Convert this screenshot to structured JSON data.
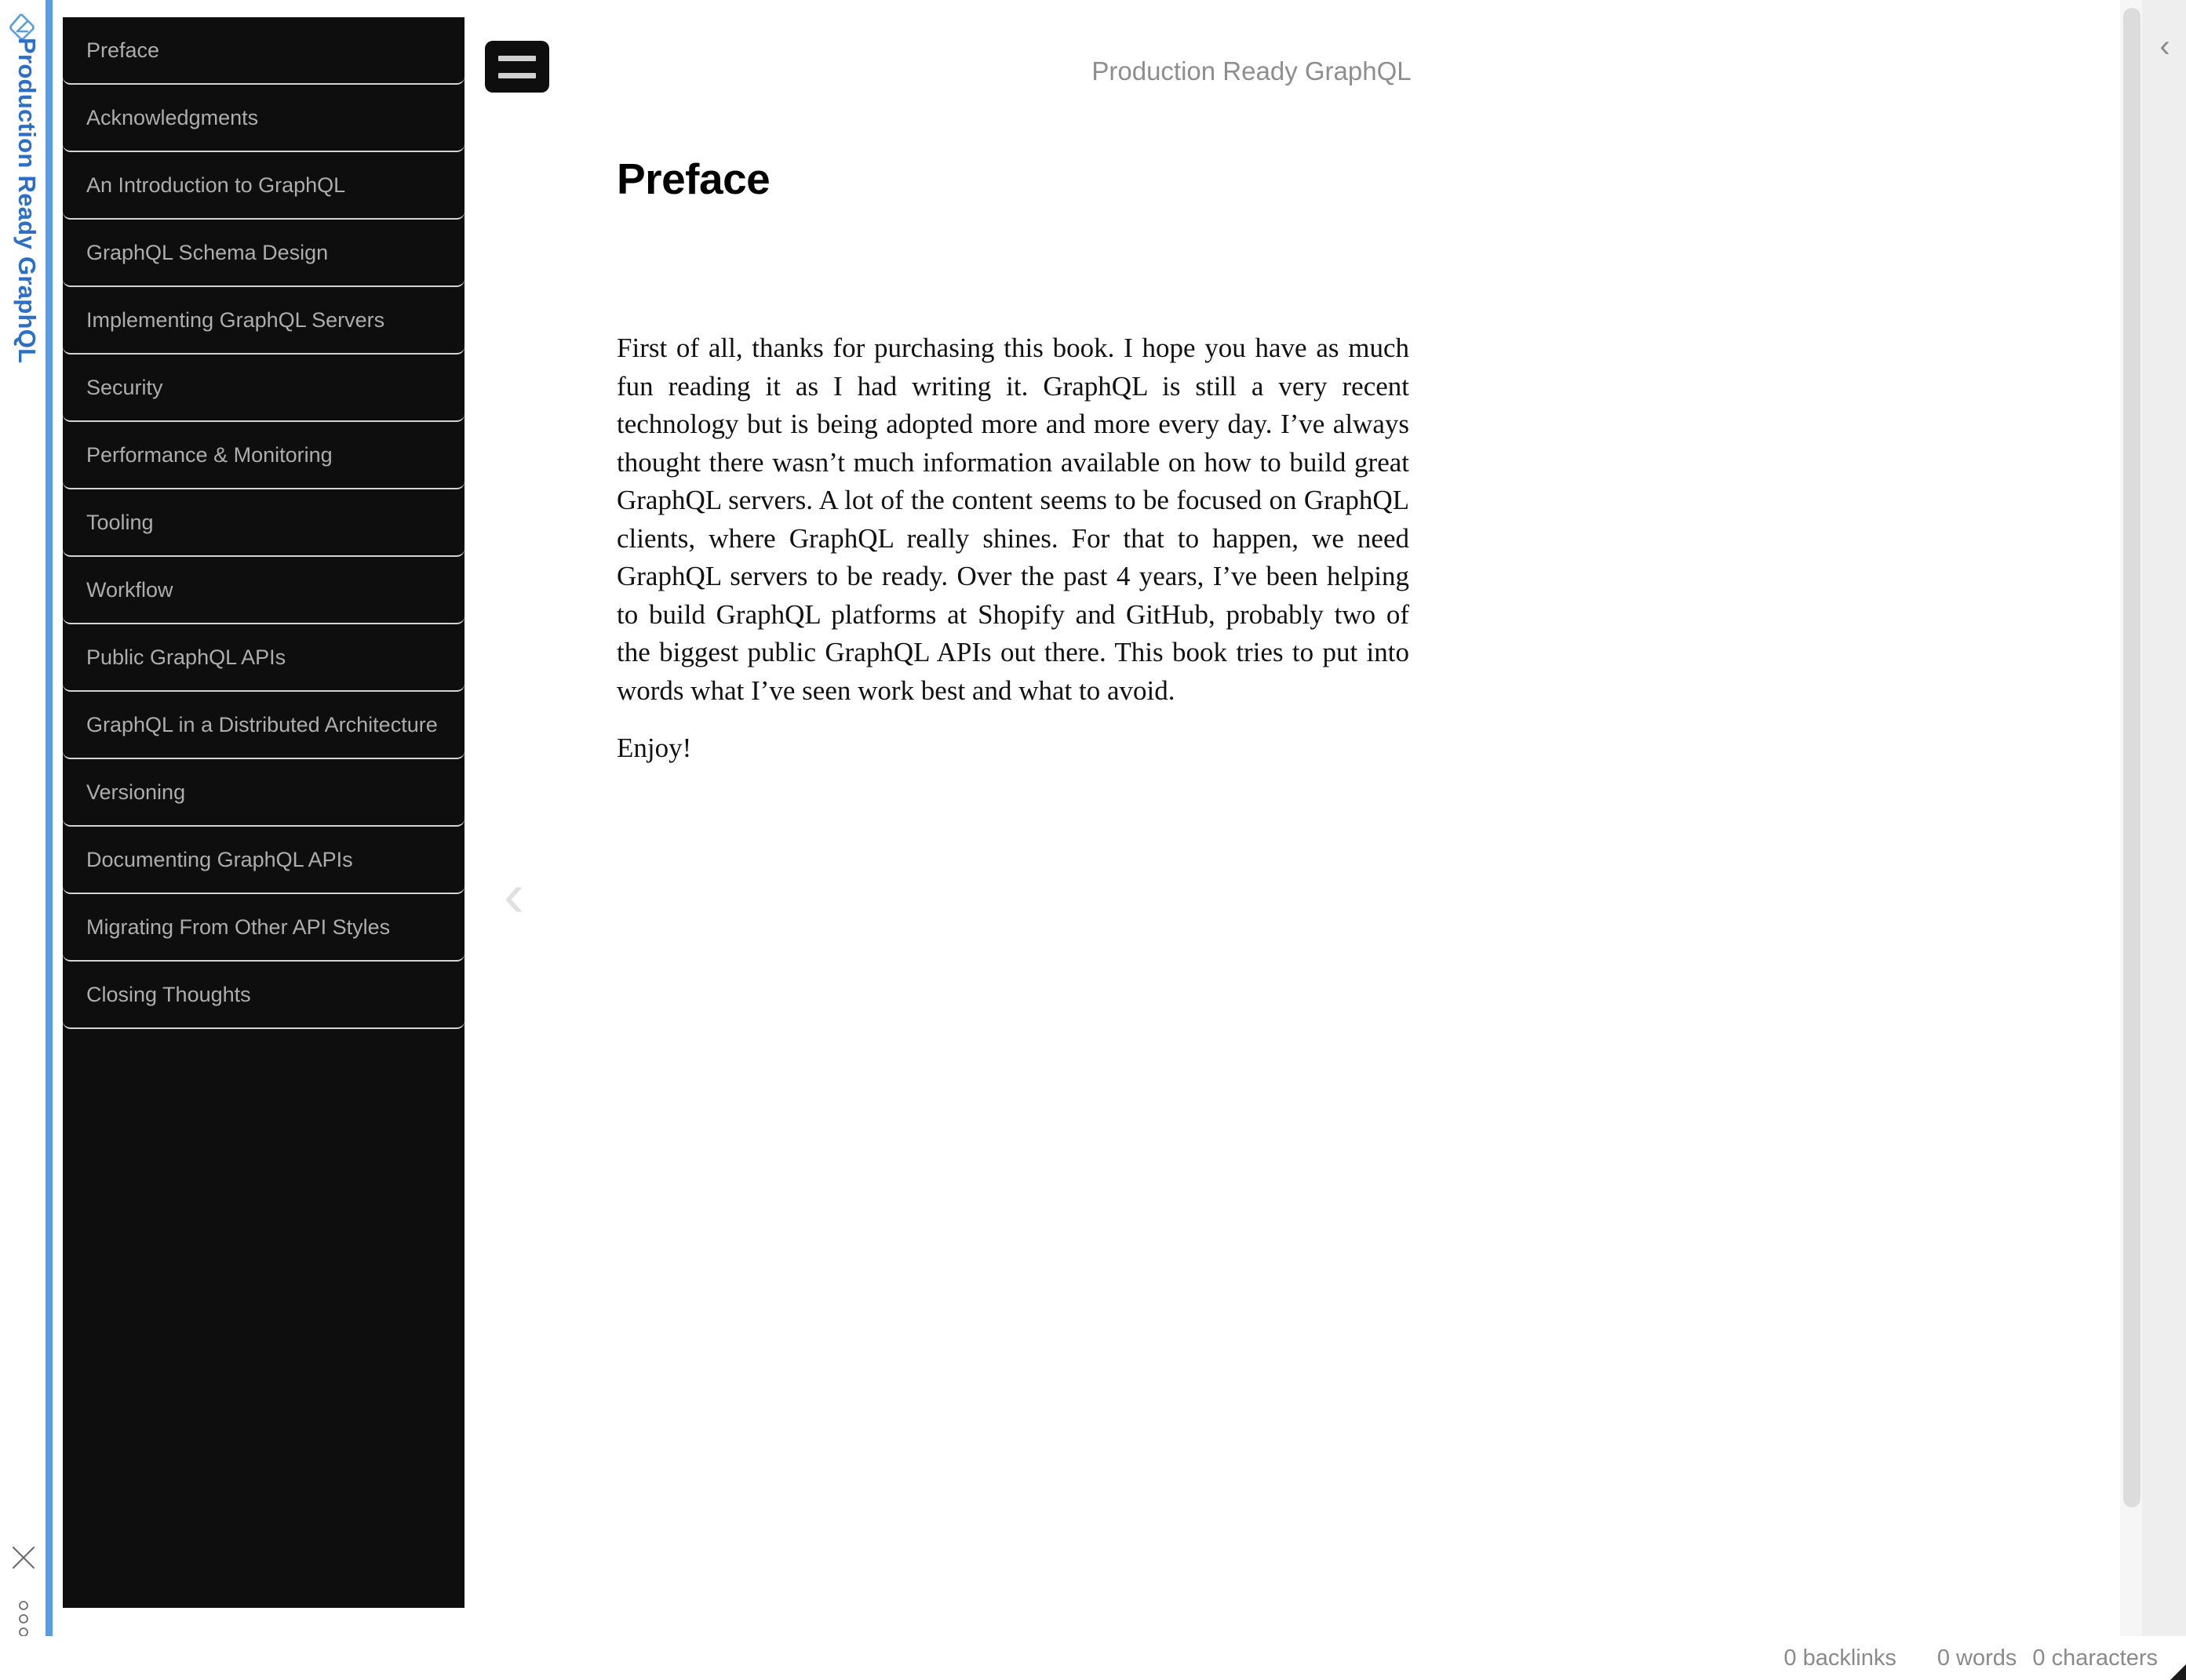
{
  "app": {
    "logo_icon": "notebook-diamond-logo",
    "rail_title": "Production Ready GraphQL",
    "close_icon": "close-icon",
    "more_icon": "more-vertical-icon",
    "accent_color": "#5b9bdf"
  },
  "sidebar": {
    "items": [
      {
        "label": "Preface"
      },
      {
        "label": "Acknowledgments"
      },
      {
        "label": "An Introduction to GraphQL"
      },
      {
        "label": "GraphQL Schema Design"
      },
      {
        "label": "Implementing GraphQL Servers"
      },
      {
        "label": "Security"
      },
      {
        "label": "Performance & Monitoring"
      },
      {
        "label": "Tooling"
      },
      {
        "label": "Workflow"
      },
      {
        "label": "Public GraphQL APIs"
      },
      {
        "label": "GraphQL in a Distributed Architecture"
      },
      {
        "label": "Versioning"
      },
      {
        "label": "Documenting GraphQL APIs"
      },
      {
        "label": "Migrating From Other API Styles"
      },
      {
        "label": "Closing Thoughts"
      }
    ]
  },
  "main": {
    "menu_button_label": "hamburger-menu",
    "doc_title": "Production Ready GraphQL",
    "collapse_chevron": "‹",
    "heading": "Preface",
    "paragraphs": [
      "First of all, thanks for purchasing this book. I hope you have as much fun reading it as I had writing it. GraphQL is still a very recent technology but is being adopted more and more every day. I’ve always thought there wasn’t much information available on how to build great GraphQL servers. A lot of the content seems to be focused on GraphQL clients, where GraphQL really shines. For that to happen, we need GraphQL servers to be ready. Over the past 4 years, I’ve been helping to build GraphQL platforms at Shopify and GitHub, probably two of the biggest public GraphQL APIs out there. This book tries to put into words what I’ve seen work best and what to avoid.",
      "Enjoy!"
    ]
  },
  "right_panel": {
    "expand_chevron": "‹"
  },
  "status_bar": {
    "backlinks": "0 backlinks",
    "words": "0 words",
    "characters": "0 characters"
  }
}
